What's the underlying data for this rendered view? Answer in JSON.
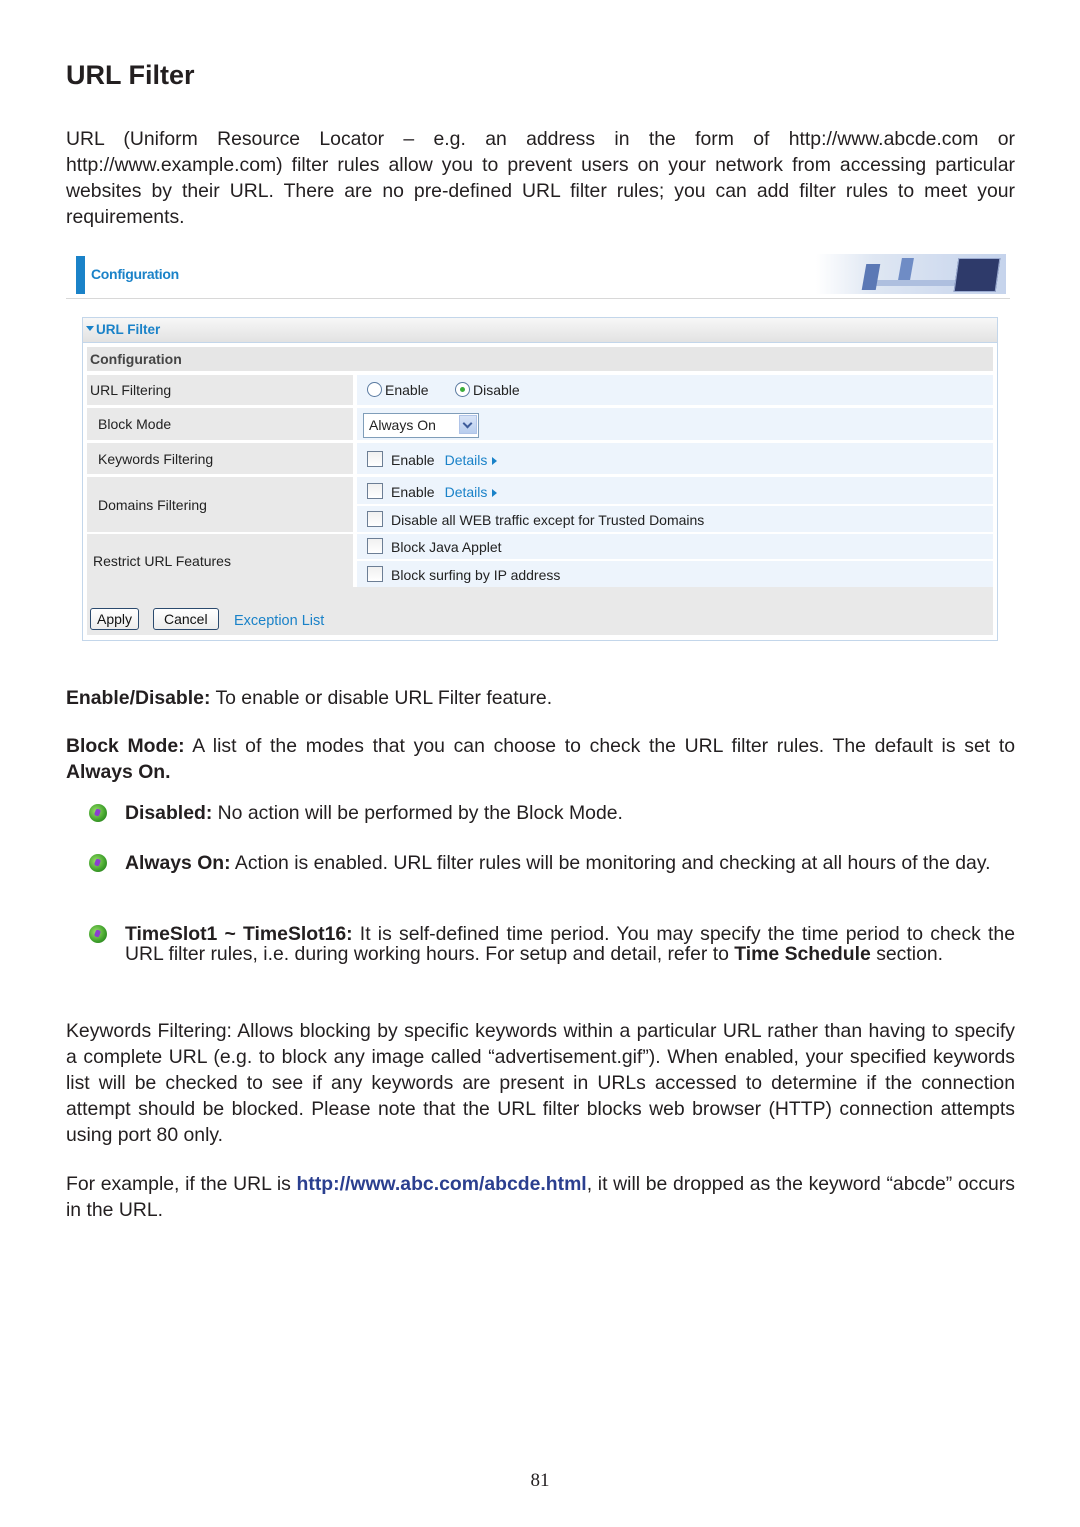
{
  "title": "URL Filter",
  "intro": "URL (Uniform Resource Locator – e.g. an address in the form of http://www.abcde.com or http://www.example.com) filter rules allow you to prevent users on your network from accessing particular websites by their URL. There are no pre-defined URL filter rules; you can add filter rules to meet your requirements.",
  "screenshot": {
    "header_title": "Configuration",
    "panel_title": "URL Filter",
    "section_title": "Configuration",
    "rows": {
      "url_filtering": {
        "label": "URL Filtering",
        "options": [
          {
            "label": "Enable",
            "selected": false
          },
          {
            "label": "Disable",
            "selected": true
          }
        ]
      },
      "block_mode": {
        "label": "Block Mode",
        "value": "Always On"
      },
      "keywords": {
        "label": "Keywords Filtering",
        "enable_label": "Enable",
        "enable_checked": false,
        "details_label": "Details"
      },
      "domains": {
        "label": "Domains Filtering",
        "enable_label": "Enable",
        "enable_checked": false,
        "details_label": "Details",
        "trusted_label": "Disable all WEB traffic except for Trusted Domains",
        "trusted_checked": false
      },
      "restrict": {
        "label": "Restrict URL Features",
        "java_label": "Block Java Applet",
        "java_checked": false,
        "ip_label": "Block surfing by IP address",
        "ip_checked": false
      }
    },
    "buttons": {
      "apply": "Apply",
      "cancel": "Cancel",
      "exception_list": "Exception List"
    }
  },
  "enable_disable": {
    "term": "Enable/Disable:",
    "text": " To enable or disable URL Filter feature."
  },
  "block_mode": {
    "term": "Block Mode:",
    "text": " A list of the modes that you can choose to check the URL filter rules. The default is set to ",
    "default": "Always On."
  },
  "modes": [
    {
      "term": "Disabled:",
      "text": " No action will be performed by the Block Mode."
    },
    {
      "term": "Always On:",
      "text": " Action is enabled.  URL filter rules will be monitoring and checking at all hours of the day."
    },
    {
      "term": "TimeSlot1 ~ TimeSlot16:",
      "text": "  It is self-defined time period.  You may specify the time period to check the URL filter rules, i.e. during working hours. For setup and detail, refer to ",
      "ref": "Time Schedule",
      "tail": " section."
    }
  ],
  "keywords_para": "Keywords Filtering: Allows blocking by specific keywords within a particular URL rather than having to specify a complete URL (e.g. to block any image called “advertisement.gif”). When enabled, your specified keywords list will be checked to see if any keywords are present in URLs accessed to determine if the connection attempt should be blocked. Please note that the URL filter blocks web browser (HTTP) connection attempts using port 80 only.",
  "example": {
    "pre": "For example, if the URL is ",
    "url": "http://www.abc.com/abcde.html",
    "post": ", it will be dropped as the keyword “abcde” occurs in the URL."
  },
  "page_number": "81",
  "colors": {
    "accent_blue": "#1a82c8",
    "link_dark_blue": "#2b3f8f",
    "label_bg": "#e9e9e9",
    "value_bg": "#edf4fc"
  }
}
